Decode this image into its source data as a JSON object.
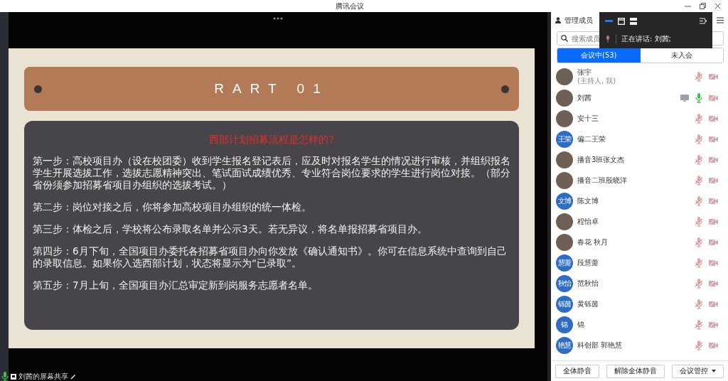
{
  "window": {
    "title": "腾讯会议"
  },
  "slide": {
    "banner": "RART 01",
    "heading": "西部计划招募流程是怎样的?",
    "paragraphs": [
      "第一步：高校项目办（设在校团委）收到学生报名登记表后，应及时对报名学生的情况进行审核，并组织报名学生开展选拔工作，选拔志愿精神突出、笔试面试成绩优秀、专业符合岗位要求的学生进行岗位对接。（部分省份须参加招募省项目办组织的选拔考试。）",
      "第二步：岗位对接之后，你将参加高校项目办组织的统一体检。",
      "第三步：体检之后，学校将公布录取名单并公示3天。若无异议，将名单报招募省项目办。",
      "第四步：6月下旬，全国项目办委托各招募省项目办向你发放《确认通知书》。你可在信息系统中查询到自己的录取信息。如果你入选西部计划，状态将显示为“已录取”。",
      "第五步：7月上旬，全国项目办汇总审定新到岗服务志愿者名单。"
    ]
  },
  "share_label": "刘茜的屏幕共享",
  "speaking_bar": {
    "text": "正在讲话:  刘茜;"
  },
  "panel": {
    "title": "管理成员",
    "search": {
      "placeholder": "搜索成员"
    },
    "tabs": [
      {
        "label": "会议中(53)",
        "selected": true
      },
      {
        "label": "未入会",
        "selected": false
      }
    ],
    "members": [
      {
        "name": "张宇",
        "note": "(主持人, 我)",
        "avatar": {
          "kind": "photo"
        },
        "muted": true,
        "sharing": false
      },
      {
        "name": "刘茜",
        "avatar": {
          "kind": "photo"
        },
        "muted": false,
        "sharing": true
      },
      {
        "name": "安十三",
        "avatar": {
          "kind": "photo"
        },
        "muted": true,
        "sharing": false
      },
      {
        "name": "偏二王荣",
        "avatar": {
          "kind": "initials",
          "text": "王荣"
        },
        "muted": true,
        "sharing": false
      },
      {
        "name": "播音3班张文杰",
        "avatar": {
          "kind": "photo"
        },
        "muted": true,
        "sharing": false
      },
      {
        "name": "播音二班殷晓洋",
        "avatar": {
          "kind": "photo"
        },
        "muted": true,
        "sharing": false
      },
      {
        "name": "陈文博",
        "avatar": {
          "kind": "initials",
          "text": "文博"
        },
        "muted": true,
        "sharing": false
      },
      {
        "name": "程怡卓",
        "avatar": {
          "kind": "photo"
        },
        "muted": true,
        "sharing": false
      },
      {
        "name": "春花 秋月",
        "avatar": {
          "kind": "photo"
        },
        "muted": true,
        "sharing": false
      },
      {
        "name": "段慧薷",
        "avatar": {
          "kind": "initials",
          "text": "慧薷"
        },
        "muted": true,
        "sharing": false
      },
      {
        "name": "范秋怡",
        "avatar": {
          "kind": "initials",
          "text": "秋怡"
        },
        "muted": true,
        "sharing": false
      },
      {
        "name": "黄铄茵",
        "avatar": {
          "kind": "initials",
          "text": "铄茵"
        },
        "muted": true,
        "sharing": false
      },
      {
        "name": "锦",
        "avatar": {
          "kind": "initials",
          "text": "锦"
        },
        "muted": true,
        "sharing": false
      },
      {
        "name": "科创部 郭艳慧",
        "avatar": {
          "kind": "initials",
          "text": "艳慧"
        },
        "muted": true,
        "sharing": false
      }
    ],
    "buttons": [
      "全体静音",
      "解除全体静音",
      "会议管控"
    ]
  }
}
